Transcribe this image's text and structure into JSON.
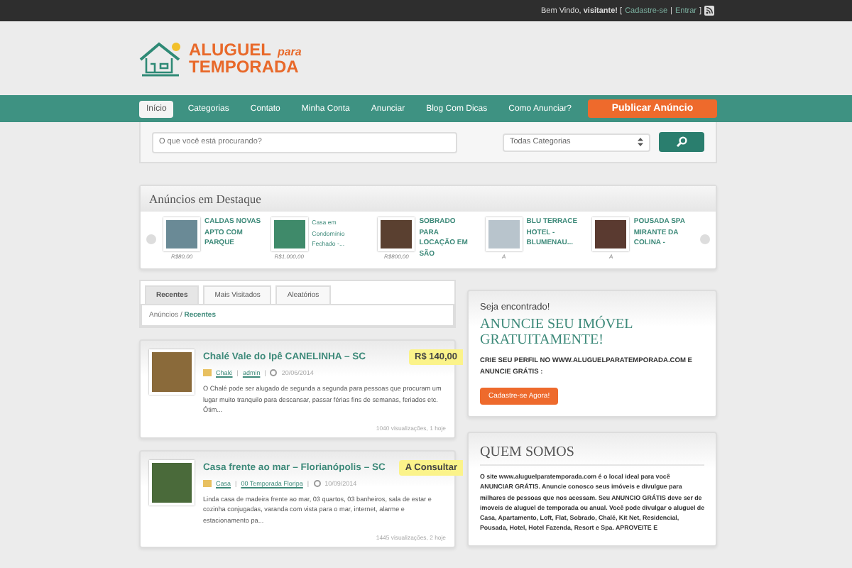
{
  "topbar": {
    "greeting": "Bem Vindo, **visitante!** [",
    "links": [
      {
        "label": "Cadastre-se"
      },
      {
        "label": "Entrar"
      }
    ],
    "separator": "|",
    "close": "]"
  },
  "logo": {
    "word1": "ALUGUEL",
    "word2": "para",
    "word3": "TEMPORADA"
  },
  "nav": {
    "items": [
      {
        "label": "Início",
        "selected": true
      },
      {
        "label": "Categorias",
        "selected": false
      },
      {
        "label": "Contato",
        "selected": false
      },
      {
        "label": "Minha Conta",
        "selected": false
      },
      {
        "label": "Anunciar",
        "selected": false
      },
      {
        "label": "Blog Com Dicas",
        "selected": false
      },
      {
        "label": "Como Anunciar?",
        "selected": false
      }
    ],
    "cta": "Publicar Anúncio"
  },
  "search": {
    "placeholder": "O que você está procurando?",
    "category": "Todas Categorias"
  },
  "featured": {
    "title": "Anúncios em Destaque",
    "items": [
      {
        "title": "CALDAS NOVAS APTO COM PARQUE",
        "price": "R$80,00",
        "bold": true,
        "color": "#6a8a96"
      },
      {
        "title": "Casa em Condomínio Fechado -...",
        "price": "R$1.000,00",
        "bold": false,
        "color": "#3f8a6a"
      },
      {
        "title": "SOBRADO PARA LOCAÇÃO EM SÃO",
        "price": "R$800,00",
        "bold": true,
        "color": "#5a4030"
      },
      {
        "title": "BLU TERRACE HOTEL - BLUMENAU...",
        "price": "A",
        "bold": true,
        "color": "#b8c4cc"
      },
      {
        "title": "POUSADA SPA MIRANTE DA COLINA -",
        "price": "A",
        "bold": true,
        "color": "#5a3a30"
      }
    ]
  },
  "tabs": [
    {
      "label": "Recentes",
      "selected": true
    },
    {
      "label": "Mais Visitados",
      "selected": false
    },
    {
      "label": "Aleatórios",
      "selected": false
    }
  ],
  "breadcrumb": {
    "root": "Anúncios",
    "separator": "/",
    "current": "Recentes"
  },
  "listings": [
    {
      "title": "Chalé Vale do Ipê CANELINHA – SC",
      "price": "R$ 140,00",
      "category": "Chalé",
      "separators": [
        "|",
        "|"
      ],
      "author": "admin",
      "date": "20/06/2014",
      "excerpt": "O Chalé pode ser alugado de segunda a segunda para pessoas que procuram um lugar muito tranquilo para descansar, passar férias fins de semanas, feriados etc. Ótim...",
      "views": "1040 visualizações, 1 hoje",
      "color": "#8a6a3a"
    },
    {
      "title": "Casa frente ao mar – Florianópolis – SC",
      "price": "A Consultar",
      "category": "Casa",
      "separators": [
        "|",
        "|"
      ],
      "author": "00 Temporada Floripa",
      "date": "10/09/2014",
      "excerpt": "Linda casa de madeira frente ao mar, 03 quartos, 03 banheiros, sala de estar e cozinha conjugadas, varanda com vista para o mar, internet, alarme e estacionamento pa...",
      "views": "1445 visualizações, 2 hoje",
      "color": "#4a6a3a"
    }
  ],
  "promo": {
    "intro": "Seja encontrado!",
    "headline": "ANUNCIE SEU IMÓVEL GRATUITAMENTE!",
    "body": "CRIE SEU PERFIL NO WWW.ALUGUELPARATEMPORADA.COM E ANUNCIE GRÁTIS :",
    "button": "Cadastre-se Agora!"
  },
  "about": {
    "title": "QUEM SOMOS",
    "text": "O site www.aluguelparatemporada.com é o local ideal para você ANUNCIAR GRÁTIS. Anuncie conosco seus imóveis e divulgue para milhares de pessoas que nos acessam. Seu ANUNCIO GRÁTIS deve ser de imoveis de aluguel de temporada ou anual. Você pode divulgar o aluguel de Casa, Apartamento, Loft, Flat, Sobrado, Chalé, Kit Net, Residencial, Pousada, Hotel, Hotel Fazenda, Resort e Spa. APROVEITE E"
  }
}
